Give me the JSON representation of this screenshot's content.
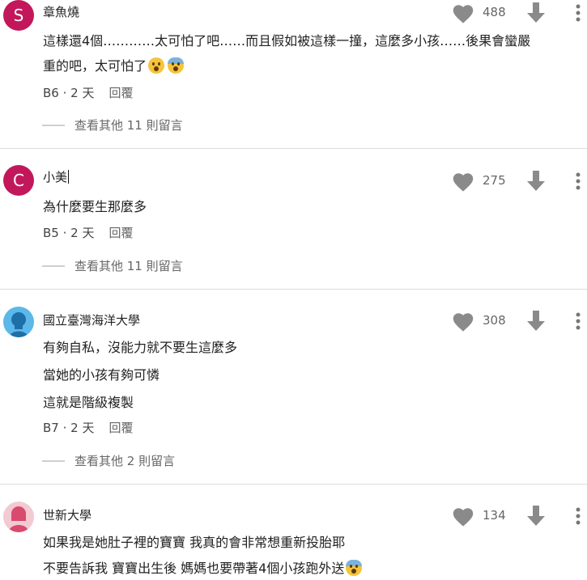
{
  "comments": [
    {
      "avatar_letter": "S",
      "avatar_color": "#c2185b",
      "author": "章魚燒",
      "likes": "488",
      "lines": [
        "這樣還4個…………太可怕了吧……而且假如被這樣一撞，這麼多小孩……後果會蠻嚴",
        "重的吧，太可怕了"
      ],
      "floor": "B6",
      "time": "2 天",
      "reply_label": "回覆",
      "more_replies": "查看其他 11 則留言"
    },
    {
      "avatar_letter": "C",
      "avatar_color": "#c2185b",
      "author": "小美",
      "likes": "275",
      "lines": [
        "為什麼要生那麼多"
      ],
      "floor": "B5",
      "time": "2 天",
      "reply_label": "回覆",
      "more_replies": "查看其他 11 則留言"
    },
    {
      "avatar_icon": "school-avatar-icon",
      "avatar_color": "#5bb8e8",
      "author": "國立臺灣海洋大學",
      "likes": "308",
      "lines": [
        "有夠自私，沒能力就不要生這麼多",
        "當她的小孩有夠可憐",
        "這就是階級複製"
      ],
      "floor": "B7",
      "time": "2 天",
      "reply_label": "回覆",
      "more_replies": "查看其他 2 則留言"
    },
    {
      "avatar_icon": "school-avatar-icon",
      "avatar_color": "#f3a6b6",
      "author": "世新大學",
      "likes": "134",
      "lines": [
        "如果我是她肚子裡的寶寶 我真的會非常想重新投胎耶",
        "不要告訴我 寶寶出生後 媽媽也要帶著4個小孩跑外送"
      ]
    }
  ],
  "icons": {
    "like": "heart-icon",
    "dislike": "arrow-down-icon",
    "menu": "more-vertical-icon",
    "emoji_1": "astonished-face-emoji",
    "emoji_2": "fearful-face-emoji"
  },
  "colors": {
    "icon_gray": "#8a8a8a",
    "divider": "#dcdcdc"
  }
}
